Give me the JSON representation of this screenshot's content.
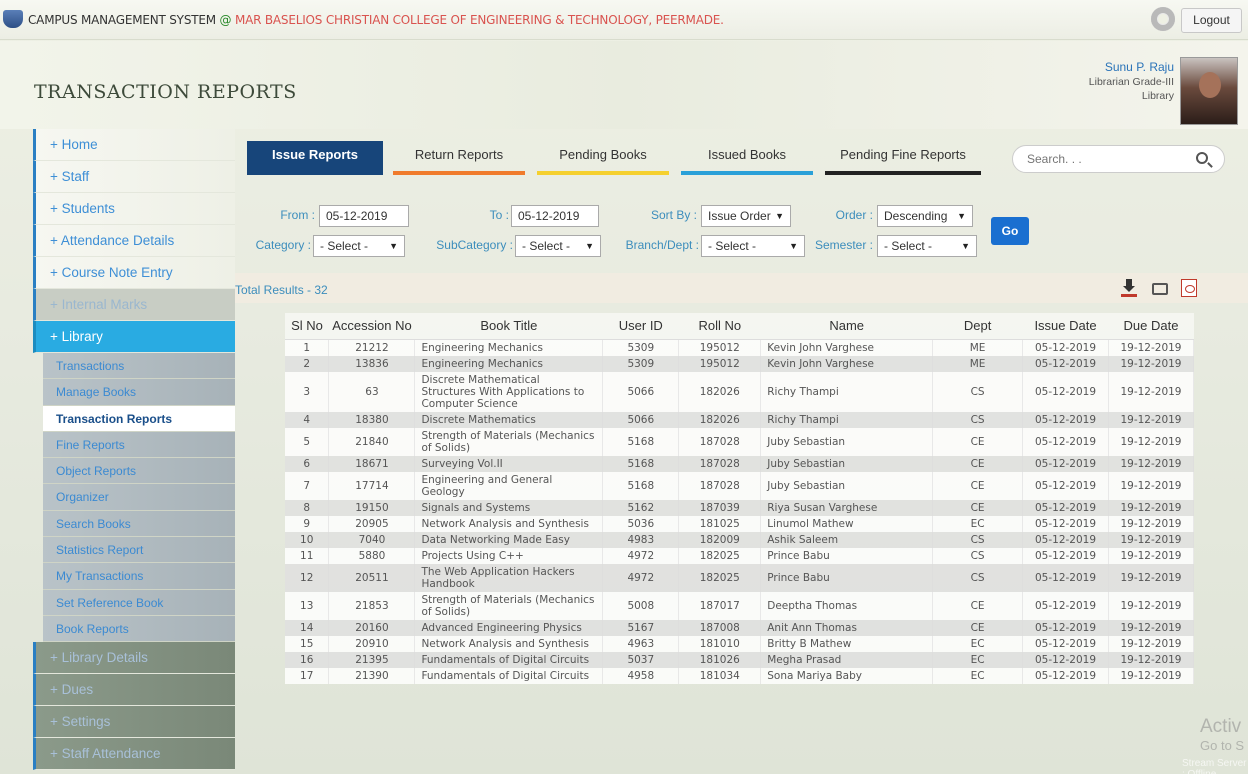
{
  "topbar": {
    "prefix": "CAMPUS MANAGEMENT SYSTEM",
    "separator": "@",
    "college": "MAR BASELIOS CHRISTIAN COLLEGE OF ENGINEERING & TECHNOLOGY, PEERMADE.",
    "logout_label": "Logout"
  },
  "header": {
    "title": "TRANSACTION REPORTS",
    "user_name": "Sunu P. Raju",
    "user_role": "Librarian Grade-III",
    "user_dept": "Library"
  },
  "sidebar": {
    "items": [
      {
        "label": "+ Home"
      },
      {
        "label": "+ Staff"
      },
      {
        "label": "+ Students"
      },
      {
        "label": "+ Attendance Details"
      },
      {
        "label": "+ Course Note Entry"
      },
      {
        "label": "+ Internal Marks"
      },
      {
        "label": "+ Library"
      }
    ],
    "sub_items": [
      {
        "label": "Transactions"
      },
      {
        "label": "Manage Books"
      },
      {
        "label": "Transaction Reports"
      },
      {
        "label": "Fine Reports"
      },
      {
        "label": "Object Reports"
      },
      {
        "label": "Organizer"
      },
      {
        "label": "Search Books"
      },
      {
        "label": "Statistics Report"
      },
      {
        "label": "My Transactions"
      },
      {
        "label": "Set Reference Book"
      },
      {
        "label": "Book Reports"
      }
    ],
    "bottom_items": [
      {
        "label": "+ Library Details"
      },
      {
        "label": "+ Dues"
      },
      {
        "label": "+ Settings"
      },
      {
        "label": "+ Staff Attendance"
      }
    ]
  },
  "tabs": [
    {
      "label": "Issue Reports",
      "color": "#17457a"
    },
    {
      "label": "Return Reports",
      "color": "#f07b2c"
    },
    {
      "label": "Pending Books",
      "color": "#f5d02f"
    },
    {
      "label": "Issued Books",
      "color": "#2aa0d8"
    },
    {
      "label": "Pending Fine Reports",
      "color": "#222222"
    }
  ],
  "search": {
    "placeholder": "Search. . ."
  },
  "filters": {
    "from_label": "From :",
    "from_value": "05-12-2019",
    "to_label": "To :",
    "to_value": "05-12-2019",
    "sort_label": "Sort By :",
    "sort_value": "Issue Order",
    "order_label": "Order :",
    "order_value": "Descending",
    "category_label": "Category :",
    "category_value": "- Select -",
    "subcategory_label": "SubCategory :",
    "subcategory_value": "- Select -",
    "branch_label": "Branch/Dept :",
    "branch_value": "- Select -",
    "semester_label": "Semester :",
    "semester_value": "- Select -",
    "go_label": "Go"
  },
  "results": {
    "total_text": "Total Results  - 32"
  },
  "table": {
    "headers": [
      "Sl No",
      "Accession No",
      "Book Title",
      "User ID",
      "Roll No",
      "Name",
      "Dept",
      "Issue Date",
      "Due Date"
    ],
    "rows": [
      [
        "1",
        "21212",
        "Engineering Mechanics",
        "5309",
        "195012",
        "Kevin John Varghese",
        "ME",
        "05-12-2019",
        "19-12-2019"
      ],
      [
        "2",
        "13836",
        "Engineering Mechanics",
        "5309",
        "195012",
        "Kevin John Varghese",
        "ME",
        "05-12-2019",
        "19-12-2019"
      ],
      [
        "3",
        "63",
        "Discrete Mathematical Structures With Applications to Computer Science",
        "5066",
        "182026",
        "Richy Thampi",
        "CS",
        "05-12-2019",
        "19-12-2019"
      ],
      [
        "4",
        "18380",
        "Discrete Mathematics",
        "5066",
        "182026",
        "Richy Thampi",
        "CS",
        "05-12-2019",
        "19-12-2019"
      ],
      [
        "5",
        "21840",
        "Strength of Materials (Mechanics of Solids)",
        "5168",
        "187028",
        "Juby Sebastian",
        "CE",
        "05-12-2019",
        "19-12-2019"
      ],
      [
        "6",
        "18671",
        "Surveying Vol.II",
        "5168",
        "187028",
        "Juby Sebastian",
        "CE",
        "05-12-2019",
        "19-12-2019"
      ],
      [
        "7",
        "17714",
        "Engineering and General Geology",
        "5168",
        "187028",
        "Juby Sebastian",
        "CE",
        "05-12-2019",
        "19-12-2019"
      ],
      [
        "8",
        "19150",
        "Signals and Systems",
        "5162",
        "187039",
        "Riya Susan Varghese",
        "CE",
        "05-12-2019",
        "19-12-2019"
      ],
      [
        "9",
        "20905",
        "Network Analysis and Synthesis",
        "5036",
        "181025",
        "Linumol Mathew",
        "EC",
        "05-12-2019",
        "19-12-2019"
      ],
      [
        "10",
        "7040",
        "Data Networking Made Easy",
        "4983",
        "182009",
        "Ashik Saleem",
        "CS",
        "05-12-2019",
        "19-12-2019"
      ],
      [
        "11",
        "5880",
        "Projects Using C++",
        "4972",
        "182025",
        "Prince Babu",
        "CS",
        "05-12-2019",
        "19-12-2019"
      ],
      [
        "12",
        "20511",
        "The Web Application Hackers Handbook",
        "4972",
        "182025",
        "Prince Babu",
        "CS",
        "05-12-2019",
        "19-12-2019"
      ],
      [
        "13",
        "21853",
        "Strength of Materials (Mechanics of Solids)",
        "5008",
        "187017",
        "Deeptha Thomas",
        "CE",
        "05-12-2019",
        "19-12-2019"
      ],
      [
        "14",
        "20160",
        "Advanced Engineering Physics",
        "5167",
        "187008",
        "Anit Ann Thomas",
        "CE",
        "05-12-2019",
        "19-12-2019"
      ],
      [
        "15",
        "20910",
        "Network Analysis and Synthesis",
        "4963",
        "181010",
        "Britty B Mathew",
        "EC",
        "05-12-2019",
        "19-12-2019"
      ],
      [
        "16",
        "21395",
        "Fundamentals of Digital Circuits",
        "5037",
        "181026",
        "Megha Prasad",
        "EC",
        "05-12-2019",
        "19-12-2019"
      ],
      [
        "17",
        "21390",
        "Fundamentals of Digital Circuits",
        "4958",
        "181034",
        "Sona Mariya Baby",
        "EC",
        "05-12-2019",
        "19-12-2019"
      ]
    ]
  },
  "watermark": {
    "line1": "Activ",
    "line2": "Go to S",
    "line3": "Stream Server : Offline"
  }
}
